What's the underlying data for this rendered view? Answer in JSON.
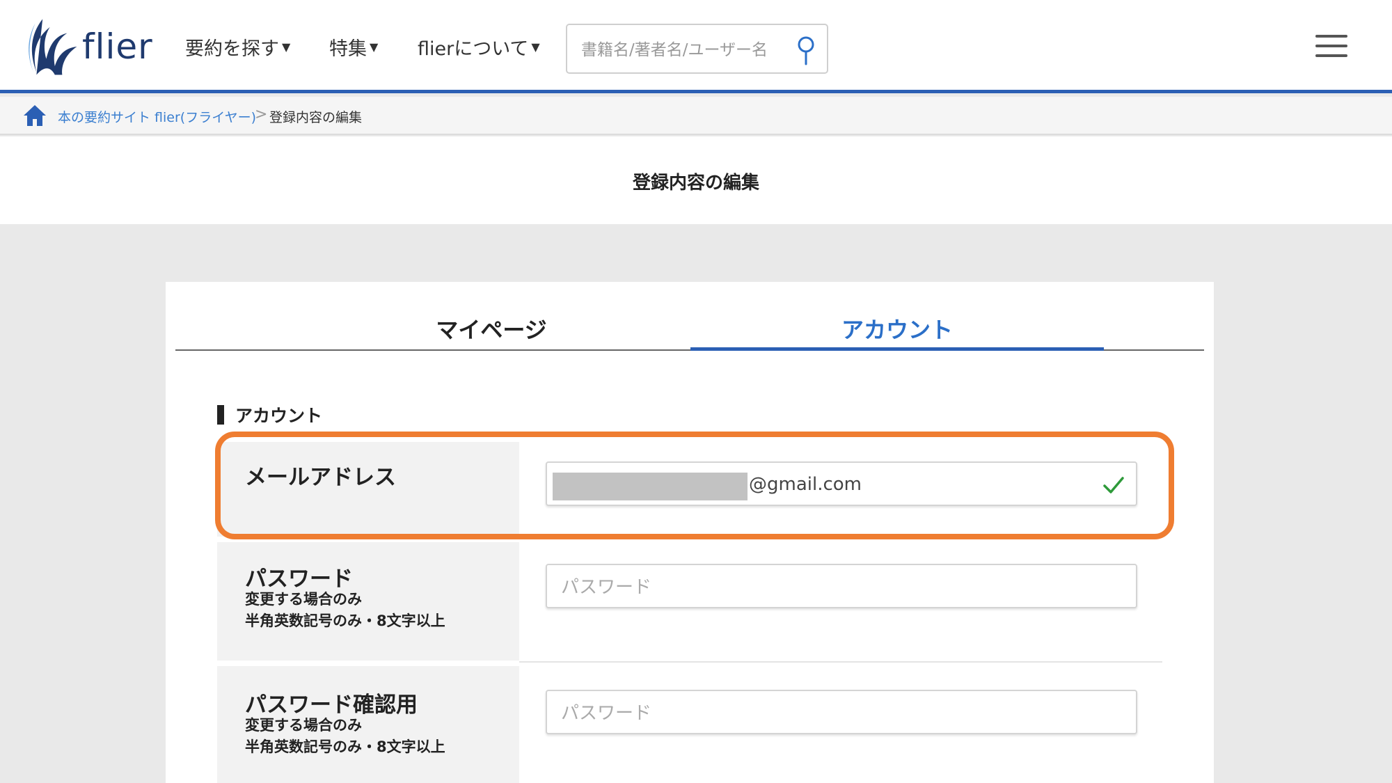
{
  "header": {
    "logo_text": "flier",
    "nav": [
      {
        "label": "要約を探す"
      },
      {
        "label": "特集"
      },
      {
        "label": "flierについて"
      }
    ],
    "search_placeholder": "書籍名/著者名/ユーザー名"
  },
  "breadcrumb": {
    "home_link": "本の要約サイト flier(フライヤー)",
    "separator": ">",
    "current": "登録内容の編集"
  },
  "page_title": "登録内容の編集",
  "tabs": [
    {
      "label": "マイページ",
      "active": false
    },
    {
      "label": "アカウント",
      "active": true
    }
  ],
  "section_heading": "アカウント",
  "fields": {
    "email": {
      "label": "メールアドレス",
      "value_domain": "@gmail.com"
    },
    "password": {
      "label": "パスワード",
      "note1": "変更する場合のみ",
      "note2": "半角英数記号のみ・8文字以上",
      "placeholder": "パスワード"
    },
    "password_confirm": {
      "label": "パスワード確認用",
      "note1": "変更する場合のみ",
      "note2": "半角英数記号のみ・8文字以上",
      "placeholder": "パスワード"
    }
  },
  "colors": {
    "brand_blue": "#2b5fb4",
    "tab_active": "#2b6fc8",
    "highlight": "#ef7d31",
    "check": "#2e9a3a"
  }
}
